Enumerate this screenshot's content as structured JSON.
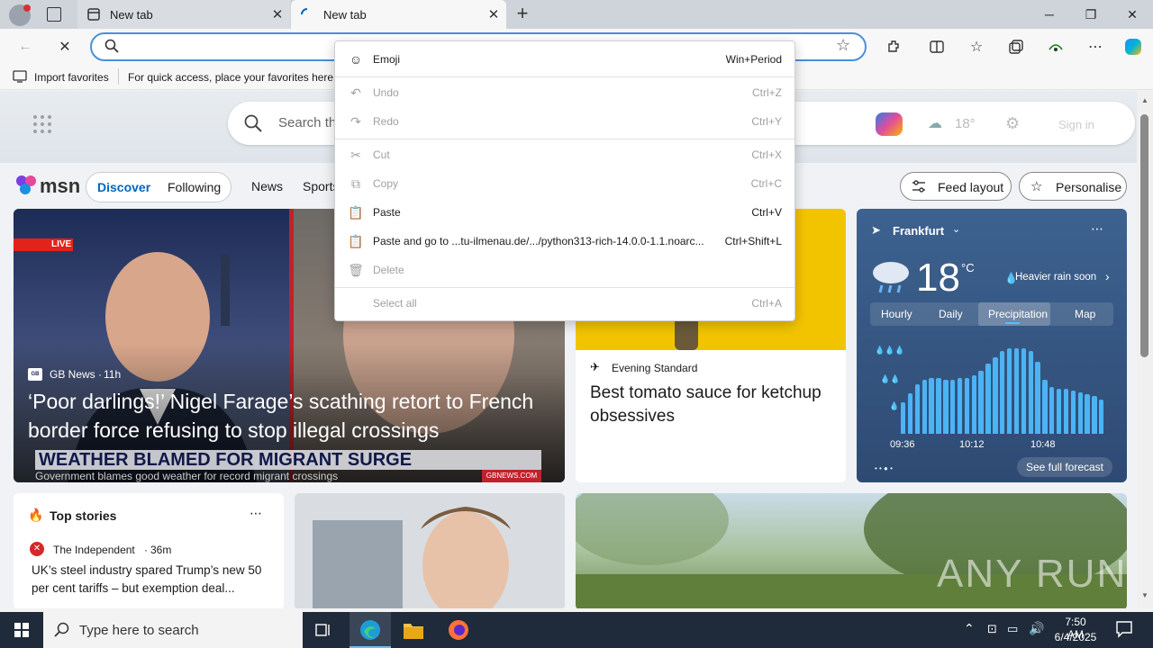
{
  "browser": {
    "tabs": [
      {
        "title": "New tab",
        "active": false
      },
      {
        "title": "New tab",
        "active": true
      }
    ],
    "new_tab_symbol": "+",
    "window_controls": [
      "minimize",
      "restore",
      "close"
    ]
  },
  "toolbar": {
    "address_value": "",
    "icons": [
      "back-icon",
      "stop-icon",
      "search-icon",
      "favorite-star-icon",
      "extensions-icon",
      "split-screen-icon",
      "favorites-icon",
      "collections-icon",
      "performance-icon",
      "more-icon",
      "copilot-icon"
    ]
  },
  "favbar": {
    "import_label": "Import favorites",
    "hint": "For quick access, place your favorites here c"
  },
  "msn": {
    "search_placeholder": "Search th",
    "logo_text": "msn",
    "temp_small": "18°",
    "sign_in": "Sign in",
    "nav": {
      "discover": "Discover",
      "following": "Following",
      "news": "News",
      "sports": "Sports"
    },
    "feed_layout": "Feed layout",
    "personalise": "Personalise"
  },
  "hero": {
    "live_badge": "LIVE",
    "source": "GB News",
    "age": "11h",
    "headline": "‘Poor darlings!’ Nigel Farage’s scathing retort to French border force refusing to stop illegal crossings",
    "banner": "WEATHER BLAMED FOR MIGRANT SURGE",
    "sub_banner": "Government blames good weather for record migrant crossings",
    "watermark": "GBNEWS.COM"
  },
  "article2": {
    "source": "Evening Standard",
    "headline": "Best tomato sauce for ketchup obsessives"
  },
  "weather": {
    "location": "Frankfurt",
    "temp": "18",
    "unit": "°C",
    "alert": "Heavier rain soon",
    "tabs": [
      "Hourly",
      "Daily",
      "Precipitation",
      "Map"
    ],
    "active_tab": "Precipitation",
    "times": [
      "09:36",
      "10:12",
      "10:48"
    ],
    "see_forecast": "See full forecast",
    "bars": [
      0.35,
      0.45,
      0.55,
      0.6,
      0.62,
      0.62,
      0.6,
      0.6,
      0.62,
      0.62,
      0.65,
      0.7,
      0.78,
      0.85,
      0.92,
      0.95,
      0.95,
      0.95,
      0.92,
      0.8,
      0.6,
      0.52,
      0.5,
      0.5,
      0.48,
      0.46,
      0.44,
      0.42,
      0.38
    ]
  },
  "top_stories": {
    "title": "Top stories",
    "source": "The Independent",
    "age": "36m",
    "headline": "UK’s steel industry spared Trump’s new 50 per cent tariffs – but exemption deal..."
  },
  "context_menu": {
    "items": [
      {
        "icon": "emoji-icon",
        "label": "Emoji",
        "shortcut": "Win+Period",
        "disabled": false
      },
      {
        "icon": "undo-icon",
        "label": "Undo",
        "shortcut": "Ctrl+Z",
        "disabled": true
      },
      {
        "icon": "redo-icon",
        "label": "Redo",
        "shortcut": "Ctrl+Y",
        "disabled": true
      },
      {
        "icon": "cut-icon",
        "label": "Cut",
        "shortcut": "Ctrl+X",
        "disabled": true
      },
      {
        "icon": "copy-icon",
        "label": "Copy",
        "shortcut": "Ctrl+C",
        "disabled": true
      },
      {
        "icon": "paste-icon",
        "label": "Paste",
        "shortcut": "Ctrl+V",
        "disabled": false
      },
      {
        "icon": "paste-go-icon",
        "label": "Paste and go to ...tu-ilmenau.de/.../python313-rich-14.0.0-1.1.noarc...",
        "shortcut": "Ctrl+Shift+L",
        "disabled": false
      },
      {
        "icon": "delete-icon",
        "label": "Delete",
        "shortcut": "",
        "disabled": true
      },
      {
        "icon": "",
        "label": "Select all",
        "shortcut": "Ctrl+A",
        "disabled": true
      }
    ]
  },
  "taskbar": {
    "search_placeholder": "Type here to search",
    "time": "7:50 AM",
    "date": "6/4/2025"
  },
  "watermark": "ANY RUN",
  "colors": {
    "accent": "#0067c0",
    "live_red": "#e2231a",
    "weather_bg": "#3a5f8f"
  }
}
